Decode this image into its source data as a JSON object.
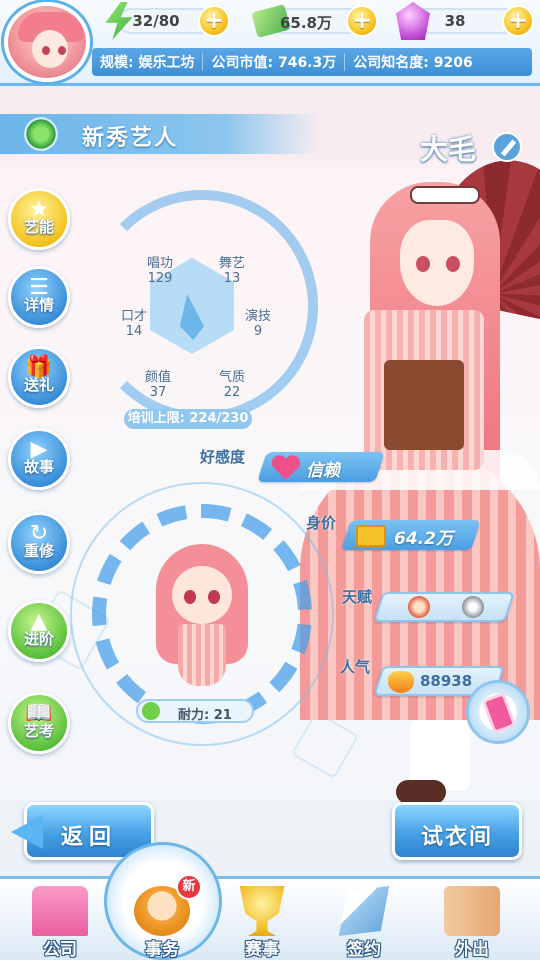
{
  "header": {
    "energy": "32/80",
    "cash": "65.8万",
    "gems": "38",
    "plus_label": "+",
    "scale_label": "规模: 娱乐工坊",
    "market_value": "公司市值: 746.3万",
    "fame": "公司知名度: 9206"
  },
  "title": {
    "category": "新秀艺人",
    "artist_name": "大毛"
  },
  "side_buttons": [
    "艺能",
    "详情",
    "送礼",
    "故事",
    "重修",
    "进阶",
    "艺考"
  ],
  "stats": {
    "singing": {
      "label": "唱功",
      "value": "129"
    },
    "dance": {
      "label": "舞艺",
      "value": "13"
    },
    "eloquence": {
      "label": "口才",
      "value": "14"
    },
    "acting": {
      "label": "演技",
      "value": "9"
    },
    "looks": {
      "label": "颜值",
      "value": "37"
    },
    "temperament": {
      "label": "气质",
      "value": "22"
    },
    "training_cap": "培训上限: 224/230"
  },
  "relation": {
    "favor_label": "好感度",
    "favor_value": "信赖",
    "worth_label": "身价",
    "worth_value": "64.2万",
    "talent_label": "天赋",
    "popularity_label": "人气",
    "popularity_value": "88938",
    "stamina": "耐力: 21"
  },
  "buttons": {
    "back": "返回",
    "fitting": "试衣间"
  },
  "nav": {
    "company": "公司",
    "affairs": "事务",
    "contest": "赛事",
    "contract": "签约",
    "outing": "外出",
    "new_badge": "新"
  },
  "colors": {
    "accent": "#4c9ee2",
    "header_bar": "#3d8fd6",
    "gold": "#f3c21f",
    "heart": "#f0508a"
  }
}
